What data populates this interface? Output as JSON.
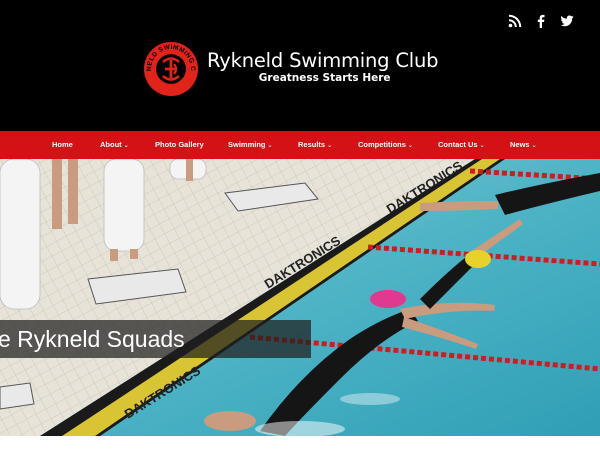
{
  "social": {
    "icons": [
      "rss-icon",
      "facebook-icon",
      "twitter-icon"
    ]
  },
  "brand": {
    "title": "Rykneld Swimming Club",
    "tagline": "Greatness Starts Here",
    "logo": {
      "ring_text": "RYKNELD SWIMMING CLUB"
    }
  },
  "nav": {
    "items": [
      {
        "label": "Home",
        "dropdown": false
      },
      {
        "label": "About",
        "dropdown": true
      },
      {
        "label": "Photo Gallery",
        "dropdown": false
      },
      {
        "label": "Swimming",
        "dropdown": true
      },
      {
        "label": "Results",
        "dropdown": true
      },
      {
        "label": "Competitions",
        "dropdown": true
      },
      {
        "label": "Contact Us",
        "dropdown": true
      },
      {
        "label": "News",
        "dropdown": true
      }
    ],
    "dropdown_glyph": "⌄"
  },
  "hero": {
    "caption": "e Rykneld Squads",
    "banner_text": "DAKTRONICS"
  },
  "colors": {
    "header_bg": "#000000",
    "nav_bg": "#d41216",
    "logo_red": "#e2231a",
    "pool_water": "#5fb9c9"
  }
}
